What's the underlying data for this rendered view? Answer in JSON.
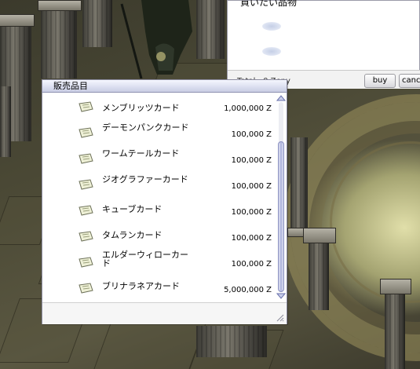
{
  "buy_window": {
    "title": "買いたい品物",
    "total_label": "Total : 0 Zeny",
    "buy_label": "buy",
    "cancel_label": "canc"
  },
  "shop_window": {
    "title": "販売品目",
    "items": [
      {
        "name": "メンブリッツカード",
        "price": "1,000,000 Z",
        "icon": "card-icon"
      },
      {
        "name": "デーモンパンクカード",
        "price": "100,000 Z",
        "icon": "card-icon"
      },
      {
        "name": "ワームテールカード",
        "price": "100,000 Z",
        "icon": "card-icon"
      },
      {
        "name": "ジオグラファーカード",
        "price": "100,000 Z",
        "icon": "card-icon"
      },
      {
        "name": "キューブカード",
        "price": "100,000 Z",
        "icon": "card-icon"
      },
      {
        "name": "タムランカード",
        "price": "100,000 Z",
        "icon": "card-icon"
      },
      {
        "name": "エルダーウィローカード",
        "price": "100,000 Z",
        "icon": "card-icon"
      },
      {
        "name": "ブリナラネアカード",
        "price": "5,000,000 Z",
        "icon": "card-icon"
      }
    ],
    "scroll_icons": [
      "scroll-up-icon",
      "scroll-down-icon",
      "resize-grip-icon"
    ]
  },
  "colors": {
    "title_bar": "#c9cde4",
    "window_border": "#8c8ca0",
    "scroll_thumb": "#aeb4dc",
    "buy_slot": "#c5cfe6"
  }
}
